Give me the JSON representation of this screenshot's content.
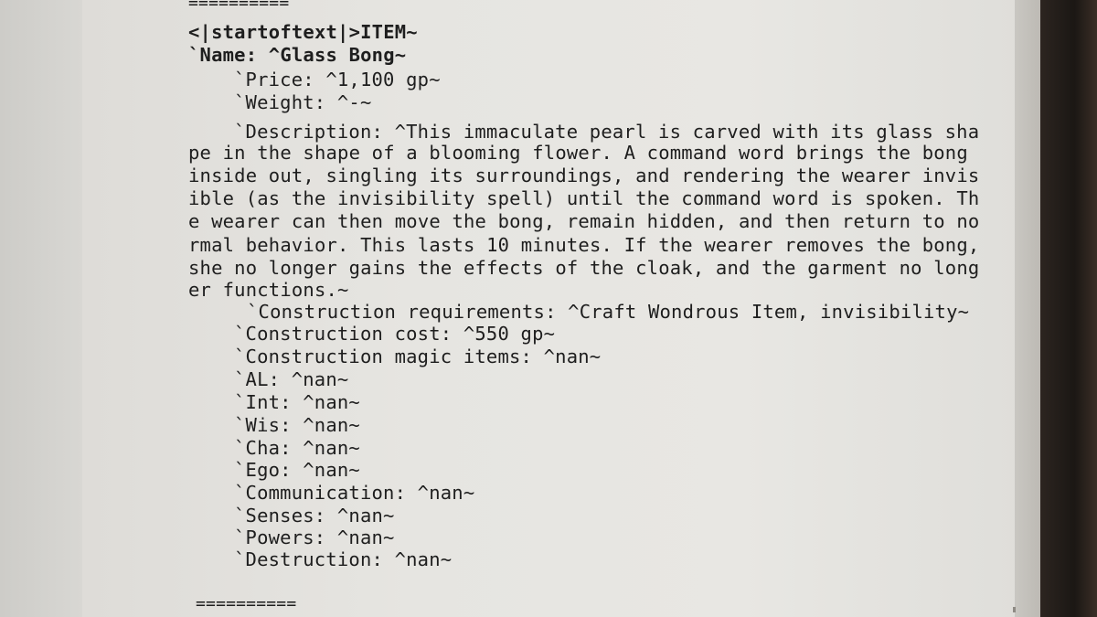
{
  "document": {
    "separator_top": "==========",
    "header": "<|startoftext|>ITEM~",
    "name_line": "`Name: ^Glass Bong~",
    "price_line": "`Price: ^1,100 gp~",
    "weight_line": "`Weight: ^-~",
    "description_lines": [
      "`Description: ^This immaculate pearl is carved with its glass sha",
      "pe in the shape of a blooming flower. A command word brings the bong",
      "inside out, singling its surroundings, and rendering the wearer invis",
      "ible (as the invisibility spell) until the command word is spoken. Th",
      "e wearer can then move the bong, remain hidden, and then return to no",
      "rmal behavior. This lasts 10 minutes. If the wearer removes the bong,",
      "she no longer gains the effects of the cloak, and the garment no long",
      "er functions.~"
    ],
    "fields": [
      "`Construction requirements: ^Craft Wondrous Item, invisibility~",
      "`Construction cost: ^550 gp~",
      "`Construction magic items: ^nan~",
      "`AL: ^nan~",
      "`Int: ^nan~",
      "`Wis: ^nan~",
      "`Cha: ^nan~",
      "`Ego: ^nan~",
      "`Communication: ^nan~",
      "`Senses: ^nan~",
      "`Powers: ^nan~",
      "`Destruction: ^nan~"
    ],
    "separator_bottom": "=========="
  }
}
